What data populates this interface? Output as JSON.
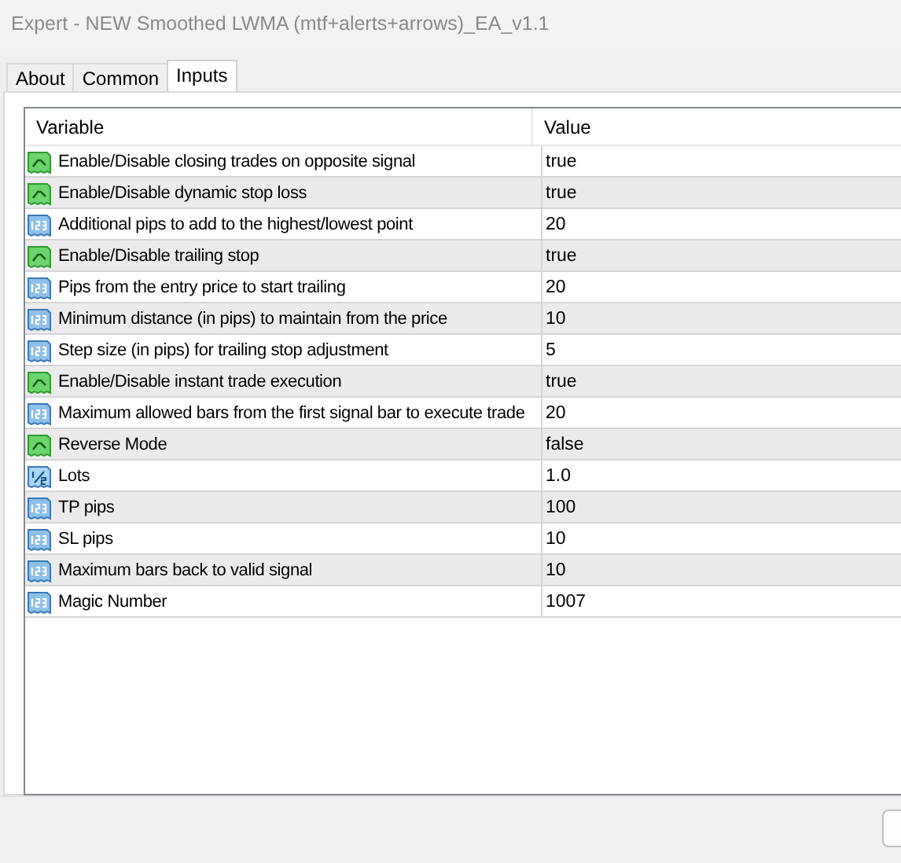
{
  "window": {
    "title": "Expert - NEW Smoothed LWMA (mtf+alerts+arrows)_EA_v1.1"
  },
  "tabs": [
    {
      "label": "About",
      "selected": false
    },
    {
      "label": "Common",
      "selected": false
    },
    {
      "label": "Inputs",
      "selected": true
    }
  ],
  "table": {
    "columns": [
      "Variable",
      "Value"
    ],
    "rows": [
      {
        "kind": "bool",
        "variable": "Enable/Disable closing trades on opposite signal",
        "value": "true"
      },
      {
        "kind": "bool",
        "variable": "Enable/Disable dynamic stop loss",
        "value": "true"
      },
      {
        "kind": "int",
        "variable": "Additional pips to add to the highest/lowest point",
        "value": "20"
      },
      {
        "kind": "bool",
        "variable": "Enable/Disable trailing stop",
        "value": "true"
      },
      {
        "kind": "int",
        "variable": "Pips from the entry price to start trailing",
        "value": "20"
      },
      {
        "kind": "int",
        "variable": "Minimum distance (in pips) to maintain from the price",
        "value": "10"
      },
      {
        "kind": "int",
        "variable": "Step size (in pips) for trailing stop adjustment",
        "value": "5"
      },
      {
        "kind": "bool",
        "variable": "Enable/Disable instant trade execution",
        "value": "true"
      },
      {
        "kind": "int",
        "variable": "Maximum allowed bars from the first signal bar to execute trade",
        "value": "20"
      },
      {
        "kind": "bool",
        "variable": "Reverse Mode",
        "value": "false"
      },
      {
        "kind": "double",
        "variable": "Lots",
        "value": "1.0"
      },
      {
        "kind": "int",
        "variable": "TP pips",
        "value": "100"
      },
      {
        "kind": "int",
        "variable": "SL pips",
        "value": "10"
      },
      {
        "kind": "int",
        "variable": "Maximum bars back to valid signal",
        "value": "10"
      },
      {
        "kind": "int",
        "variable": "Magic Number",
        "value": "1007"
      }
    ]
  }
}
